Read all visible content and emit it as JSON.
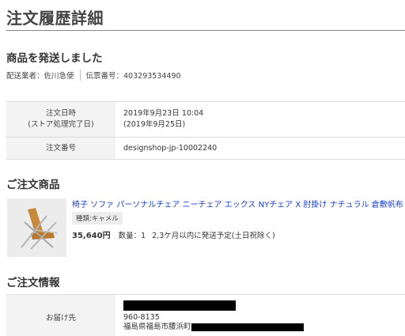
{
  "page": {
    "title": "注文履歴詳細"
  },
  "shipping": {
    "heading": "商品を発送しました",
    "carrier": "配送業者：佐川急便",
    "tracking": "伝票番号：403293534490"
  },
  "order": {
    "rows": [
      {
        "label_lines": [
          "注文日時",
          "(ストア処理完了日)"
        ],
        "value_lines": [
          "2019年9月23日 10:04",
          "(2019年9月25日)"
        ]
      },
      {
        "label_lines": [
          "注文番号"
        ],
        "value_lines": [
          "designshop-jp-10002240"
        ]
      }
    ]
  },
  "items": {
    "heading": "ご注文商品",
    "list": [
      {
        "name": "椅子 ソファ パーソナルチェア ニーチェア エックス NYチェア X 肘掛け ナチュラル 倉敷帆布",
        "variant": "種類:キャメル",
        "price": "35,640円",
        "quantity": "数量：1",
        "delivery": "2,3ケ月以内に発送予定(土日祝除く)"
      }
    ]
  },
  "order_info": {
    "heading": "ご注文情報",
    "rows": [
      {
        "label": "お届け先",
        "postal": "960-8135",
        "address": "福島県福島市腰浜町"
      }
    ]
  },
  "colors": {
    "link": "#1a3fc9",
    "header_cell": "#f3f3f3",
    "redaction": "#000000"
  }
}
